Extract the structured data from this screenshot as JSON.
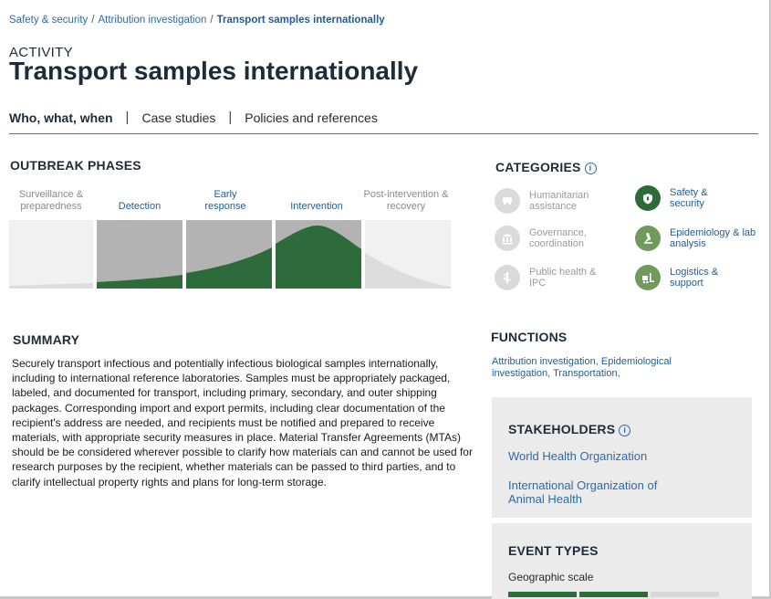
{
  "breadcrumb": {
    "items": [
      "Safety & security",
      "Attribution investigation"
    ],
    "separator": "/",
    "current": "Transport samples internationally"
  },
  "header": {
    "kicker": "ACTIVITY",
    "title": "Transport samples internationally"
  },
  "tabs": [
    {
      "label": "Who, what, when",
      "active": true
    },
    {
      "label": "Case studies",
      "active": false
    },
    {
      "label": "Policies and references",
      "active": false
    }
  ],
  "tab_divider": "|",
  "outbreak_phases": {
    "heading": "OUTBREAK PHASES",
    "phases": [
      {
        "label": "Surveillance & preparedness",
        "active": false
      },
      {
        "label": "Detection",
        "active": true
      },
      {
        "label": "Early response",
        "active": true
      },
      {
        "label": "Intervention",
        "active": true
      },
      {
        "label": "Post-intervention & recovery",
        "active": false
      }
    ]
  },
  "categories": {
    "heading": "CATEGORIES",
    "info_icon": "info-icon",
    "items": [
      {
        "label": "Humanitarian assistance",
        "active": false,
        "icon": "vehicle-icon"
      },
      {
        "label": "Safety & security",
        "active": true,
        "icon": "shield-icon"
      },
      {
        "label": "Governance, coordination",
        "active": false,
        "icon": "building-icon"
      },
      {
        "label": "Epidemiology & lab analysis",
        "active": true,
        "icon": "microscope-icon"
      },
      {
        "label": "Public health & IPC",
        "active": false,
        "icon": "health-icon"
      },
      {
        "label": "Logistics & support",
        "active": true,
        "icon": "forklift-icon"
      }
    ]
  },
  "summary": {
    "heading": "SUMMARY",
    "text": "Securely transport infectious and potentially infectious biological samples internationally, including to international reference laboratories. Samples must be appropriately packaged, labeled, and documented for transport, including primary, secondary, and outer shipping packages. Corresponding import and export permits, including clear documentation of the recipient's address are needed, and recipients must be notified and prepared to receive materials, with appropriate security measures in place. Material Transfer Agreements (MTAs) should be be considered wherever possible to clarify how materials can and cannot be used for research purposes by the recipient, whether materials can be passed to third parties, and to clarify intellectual property rights and plans for long-term storage."
  },
  "functions": {
    "heading": "FUNCTIONS",
    "items": [
      "Attribution investigation,",
      "Epidemiological investigation,",
      "Transportation,"
    ]
  },
  "stakeholders": {
    "heading": "STAKEHOLDERS",
    "items": [
      "World Health Organization",
      "International Organization of Animal Health"
    ]
  },
  "event_types": {
    "heading": "EVENT TYPES",
    "scale_label": "Geographic scale"
  },
  "colors": {
    "brand_green": "#2e6b3a",
    "link_blue": "#2c6aa8",
    "inactive_gray": "#dadada"
  }
}
